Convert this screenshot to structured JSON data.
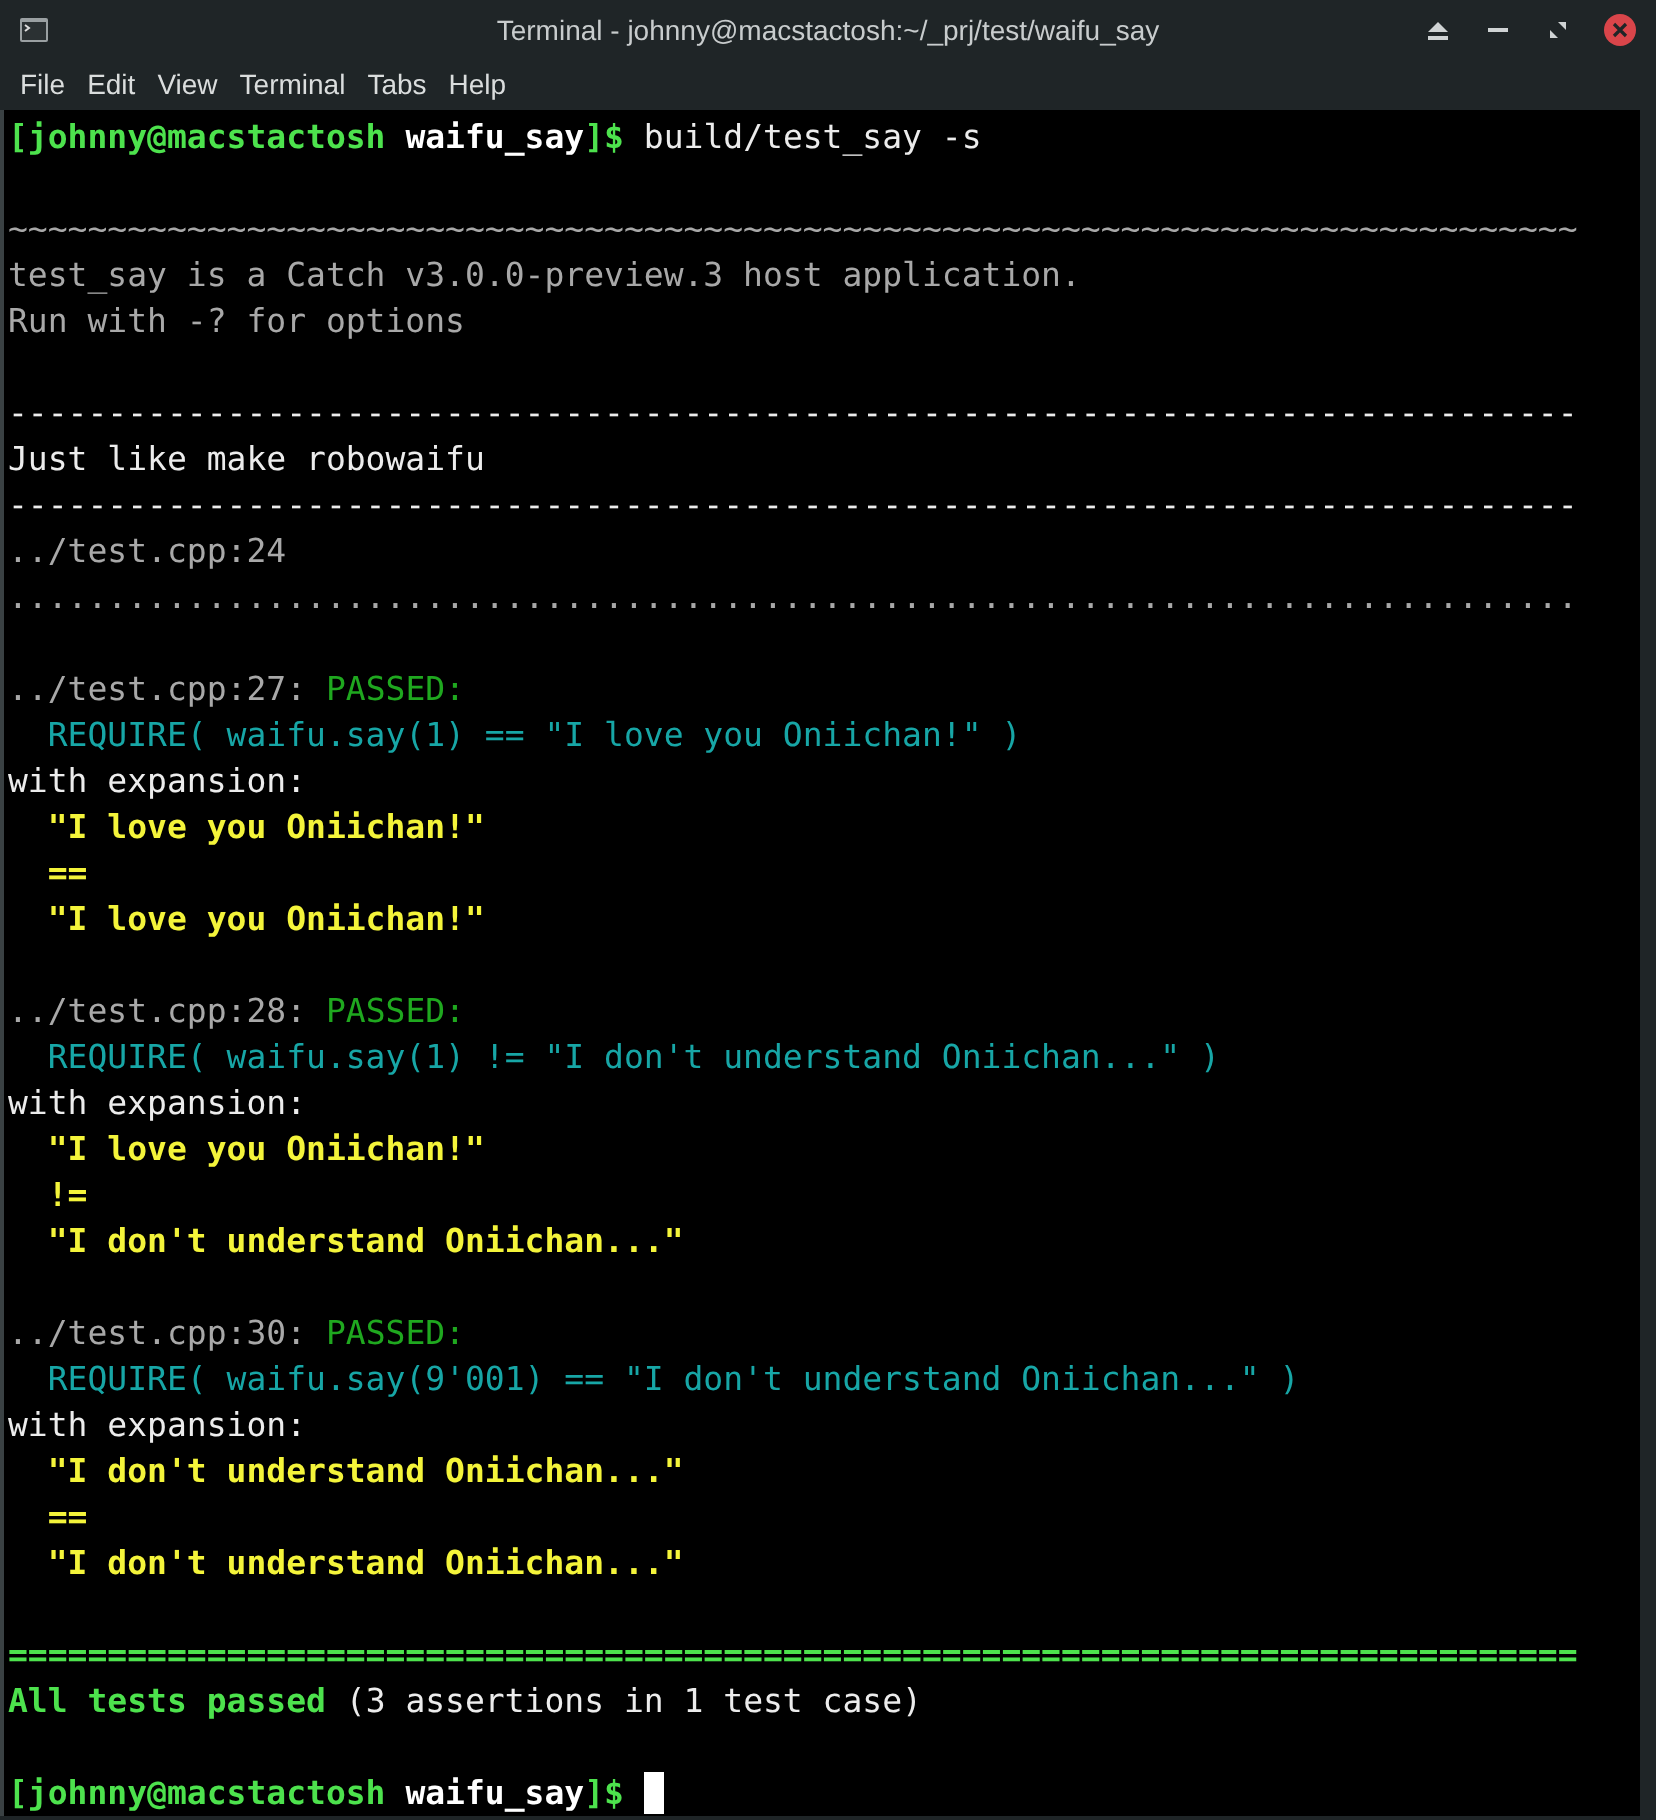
{
  "window": {
    "title": "Terminal - johnny@macstactosh:~/_prj/test/waifu_say"
  },
  "menu": [
    "File",
    "Edit",
    "View",
    "Terminal",
    "Tabs",
    "Help"
  ],
  "terminal": {
    "cursor_visible": true,
    "lines": [
      {
        "kind": "text",
        "segments": [
          {
            "kind": "prompt",
            "text": "[johnny@macstactosh "
          },
          {
            "kind": "dir",
            "text": "waifu_say"
          },
          {
            "kind": "prompt",
            "text": "]$ "
          },
          {
            "kind": "plain",
            "text": "build/test_say -s"
          }
        ]
      },
      {
        "kind": "blank"
      },
      {
        "kind": "text",
        "segments": [
          {
            "kind": "dim",
            "text": "~~~~~~~~~~~~~~~~~~~~~~~~~~~~~~~~~~~~~~~~~~~~~~~~~~~~~~~~~~~~~~~~~~~~~~~~~~~~~~~"
          }
        ]
      },
      {
        "kind": "text",
        "segments": [
          {
            "kind": "dim",
            "text": "test_say is a Catch v3.0.0-preview.3 host application."
          }
        ]
      },
      {
        "kind": "text",
        "segments": [
          {
            "kind": "dim",
            "text": "Run with -? for options"
          }
        ]
      },
      {
        "kind": "blank"
      },
      {
        "kind": "text",
        "segments": [
          {
            "kind": "plain",
            "text": "-------------------------------------------------------------------------------"
          }
        ]
      },
      {
        "kind": "text",
        "segments": [
          {
            "kind": "plain",
            "text": "Just like make robowaifu"
          }
        ]
      },
      {
        "kind": "text",
        "segments": [
          {
            "kind": "plain",
            "text": "-------------------------------------------------------------------------------"
          }
        ]
      },
      {
        "kind": "text",
        "segments": [
          {
            "kind": "dim",
            "text": "../test.cpp:24"
          }
        ]
      },
      {
        "kind": "text",
        "segments": [
          {
            "kind": "dim",
            "text": "..............................................................................."
          }
        ]
      },
      {
        "kind": "blank"
      },
      {
        "kind": "text",
        "segments": [
          {
            "kind": "dim",
            "text": "../test.cpp:27: "
          },
          {
            "kind": "passed",
            "text": "PASSED:"
          }
        ]
      },
      {
        "kind": "text",
        "segments": [
          {
            "kind": "macro",
            "text": "  REQUIRE( waifu.say(1) == \"I love you Oniichan!\" )"
          }
        ]
      },
      {
        "kind": "text",
        "segments": [
          {
            "kind": "plain",
            "text": "with expansion:"
          }
        ]
      },
      {
        "kind": "text",
        "segments": [
          {
            "kind": "value",
            "text": "  \"I love you Oniichan!\""
          }
        ]
      },
      {
        "kind": "text",
        "segments": [
          {
            "kind": "value",
            "text": "  =="
          }
        ]
      },
      {
        "kind": "text",
        "segments": [
          {
            "kind": "value",
            "text": "  \"I love you Oniichan!\""
          }
        ]
      },
      {
        "kind": "blank"
      },
      {
        "kind": "text",
        "segments": [
          {
            "kind": "dim",
            "text": "../test.cpp:28: "
          },
          {
            "kind": "passed",
            "text": "PASSED:"
          }
        ]
      },
      {
        "kind": "text",
        "segments": [
          {
            "kind": "macro",
            "text": "  REQUIRE( waifu.say(1) != \"I don't understand Oniichan...\" )"
          }
        ]
      },
      {
        "kind": "text",
        "segments": [
          {
            "kind": "plain",
            "text": "with expansion:"
          }
        ]
      },
      {
        "kind": "text",
        "segments": [
          {
            "kind": "value",
            "text": "  \"I love you Oniichan!\""
          }
        ]
      },
      {
        "kind": "text",
        "segments": [
          {
            "kind": "value",
            "text": "  !="
          }
        ]
      },
      {
        "kind": "text",
        "segments": [
          {
            "kind": "value",
            "text": "  \"I don't understand Oniichan...\""
          }
        ]
      },
      {
        "kind": "blank"
      },
      {
        "kind": "text",
        "segments": [
          {
            "kind": "dim",
            "text": "../test.cpp:30: "
          },
          {
            "kind": "passed",
            "text": "PASSED:"
          }
        ]
      },
      {
        "kind": "text",
        "segments": [
          {
            "kind": "macro",
            "text": "  REQUIRE( waifu.say(9'001) == \"I don't understand Oniichan...\" )"
          }
        ]
      },
      {
        "kind": "text",
        "segments": [
          {
            "kind": "plain",
            "text": "with expansion:"
          }
        ]
      },
      {
        "kind": "text",
        "segments": [
          {
            "kind": "value",
            "text": "  \"I don't understand Oniichan...\""
          }
        ]
      },
      {
        "kind": "text",
        "segments": [
          {
            "kind": "value",
            "text": "  =="
          }
        ]
      },
      {
        "kind": "text",
        "segments": [
          {
            "kind": "value",
            "text": "  \"I don't understand Oniichan...\""
          }
        ]
      },
      {
        "kind": "blank"
      },
      {
        "kind": "text",
        "segments": [
          {
            "kind": "summary",
            "text": "==============================================================================="
          }
        ]
      },
      {
        "kind": "text",
        "segments": [
          {
            "kind": "summary",
            "text": "All tests passed"
          },
          {
            "kind": "plain",
            "text": " (3 assertions in 1 test case)"
          }
        ]
      },
      {
        "kind": "blank"
      },
      {
        "kind": "text",
        "segments": [
          {
            "kind": "prompt",
            "text": "[johnny@macstactosh "
          },
          {
            "kind": "dir",
            "text": "waifu_say"
          },
          {
            "kind": "prompt",
            "text": "]$ "
          }
        ]
      }
    ]
  }
}
